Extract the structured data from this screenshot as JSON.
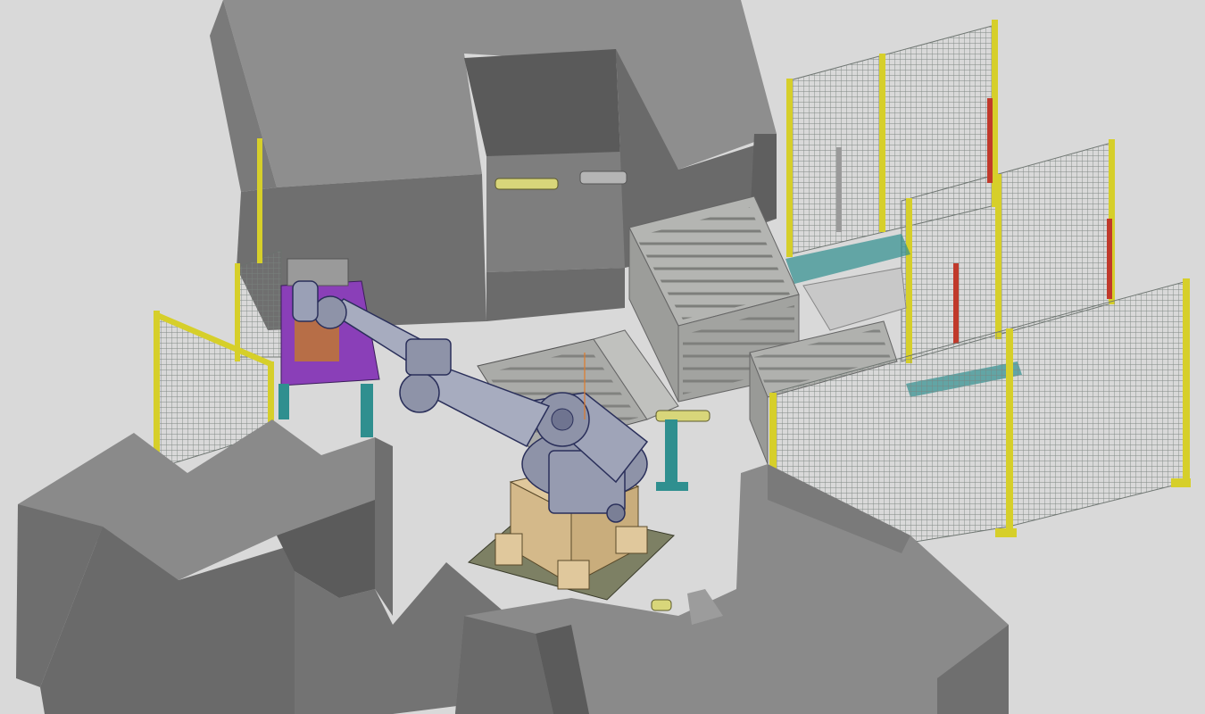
{
  "scene": {
    "kind": "3d-cad-render",
    "subject": "robotic-cell-layout",
    "components": [
      "building-block-top",
      "building-block-bottom-left",
      "building-block-bottom-right",
      "industrial-robot",
      "robot-pedestal",
      "fixture-table",
      "rack-conveyor-stack",
      "part-trays",
      "safety-fence-panels",
      "gripped-part-shafts",
      "light-curtains"
    ]
  },
  "colors": {
    "background": "#d9d9d9",
    "block_top": "#8a8a8a",
    "block_front": "#6e6e6e",
    "block_dark": "#5b5b5b",
    "block_shadow": "#4a4a4a",
    "fence_post": "#d6cf2a",
    "fence_mesh": "#8f9894",
    "robot_body": "#8e93a8",
    "robot_outline": "#2a2f5a",
    "pedestal": "#d4b98a",
    "base_plate": "#7d8064",
    "teal": "#2f8f8f",
    "table_purple": "#8a3fb8",
    "rack": "#a9aaa8",
    "shaft": "#d8d67a",
    "light_curtain": "#c0392b"
  }
}
